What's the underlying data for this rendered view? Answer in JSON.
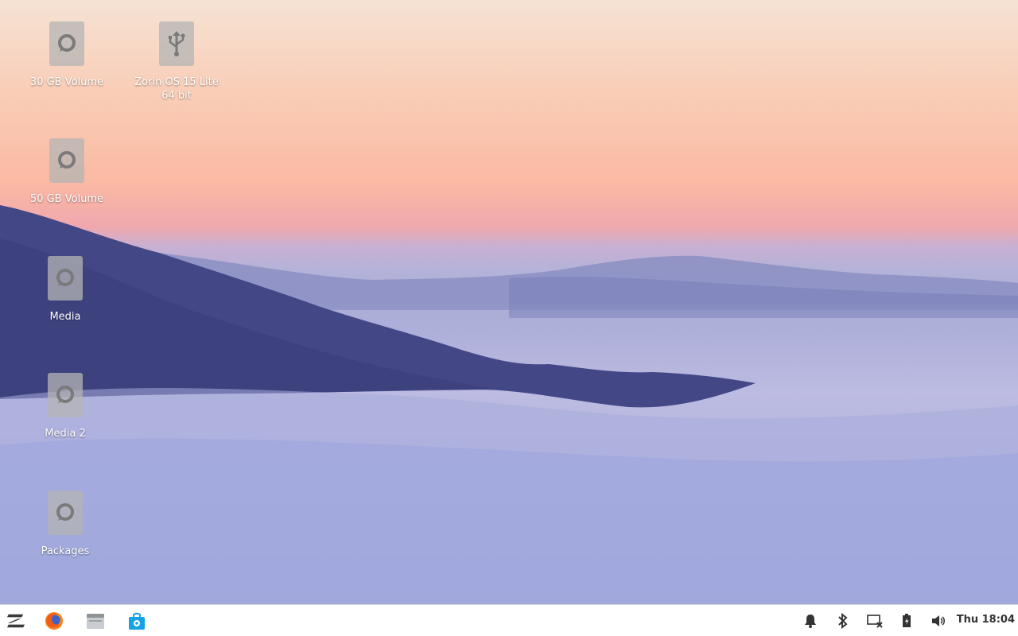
{
  "desktop": {
    "icons": [
      {
        "label": "30 GB Volume",
        "icon": "hard-drive-icon"
      },
      {
        "label": "Zorin OS 15 Lite 64 bit",
        "icon": "usb-drive-icon"
      },
      {
        "label": "50 GB Volume",
        "icon": "hard-drive-icon"
      },
      {
        "label": "Media",
        "icon": "hard-drive-icon"
      },
      {
        "label": "Media 2",
        "icon": "hard-drive-icon"
      },
      {
        "label": "Packages",
        "icon": "hard-drive-icon"
      }
    ]
  },
  "taskbar": {
    "launchers": [
      {
        "name": "zorin-menu-icon"
      },
      {
        "name": "firefox-icon"
      },
      {
        "name": "files-icon"
      },
      {
        "name": "software-store-icon"
      }
    ],
    "tray": [
      {
        "name": "notifications-bell-icon"
      },
      {
        "name": "bluetooth-icon"
      },
      {
        "name": "network-disconnected-icon"
      },
      {
        "name": "battery-charging-icon"
      },
      {
        "name": "volume-icon"
      }
    ],
    "clock": "Thu 18:04"
  },
  "colors": {
    "taskbar_bg": "#ffffff",
    "icon_tile": "#b4b4b4",
    "firefox_orange": "#f7831e",
    "store_blue": "#14a3e6"
  }
}
